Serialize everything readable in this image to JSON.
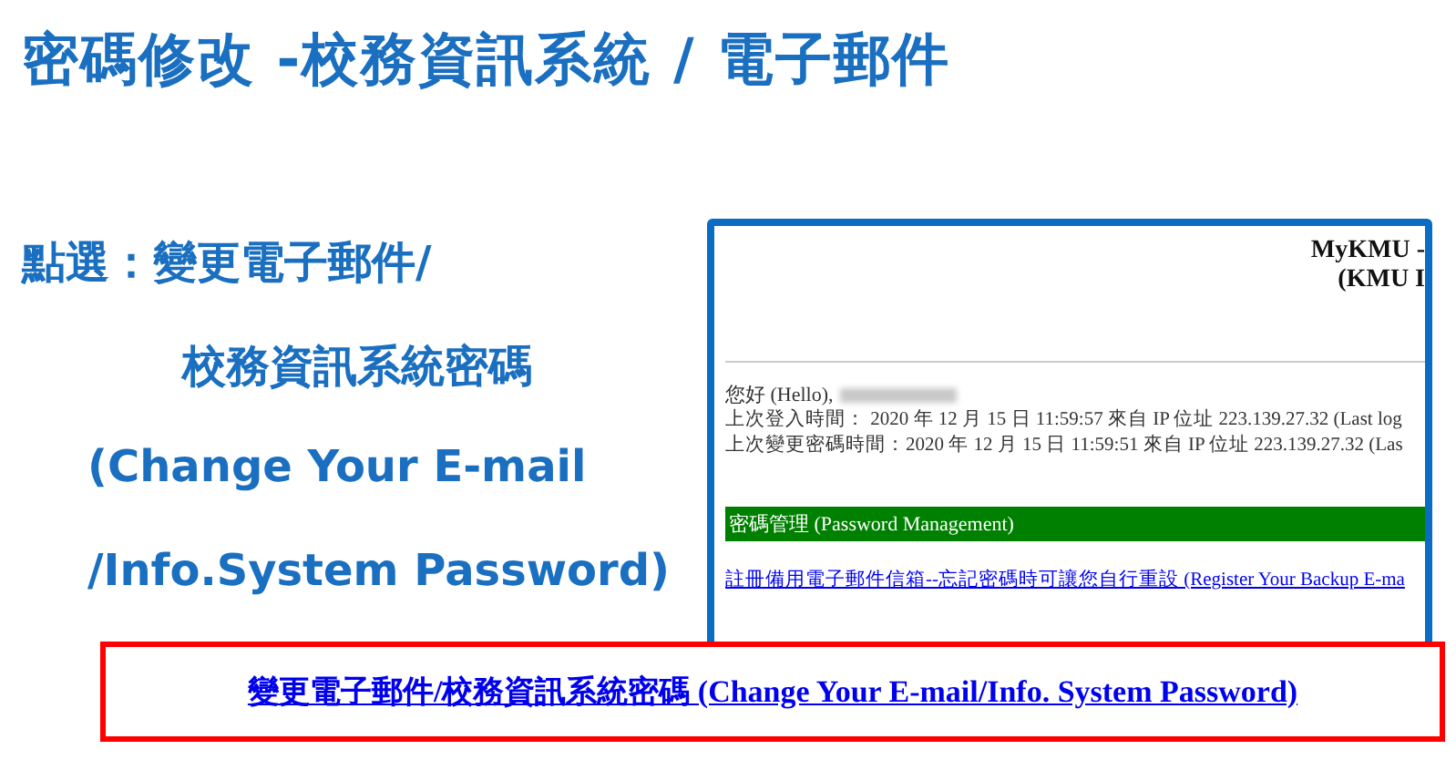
{
  "slide": {
    "title": "密碼修改 -校務資訊系統 / 電子郵件",
    "instructions": [
      "點選：變更電子郵件/",
      "校務資訊系統密碼",
      "(Change Your E-mail",
      "/Info.System Password)"
    ]
  },
  "screenshot": {
    "header": [
      "MyKMU -",
      "(KMU I"
    ],
    "greeting": "您好 (Hello),",
    "info_lines": [
      "上次登入時間： 2020 年 12 月 15 日 11:59:57 來自 IP 位址 223.139.27.32 (Last log",
      "上次變更密碼時間：2020 年 12 月 15 日 11:59:51 來自 IP 位址 223.139.27.32 (Las"
    ],
    "section_bar": "密碼管理 (Password Management)",
    "links": [
      "註冊備用電子郵件信箱--忘記密碼時可讓您自行重設 (Register Your Backup E-ma"
    ]
  },
  "highlighted_link": "變更電子郵件/校務資訊系統密碼 (Change Your E-mail/Info. System Password)"
}
